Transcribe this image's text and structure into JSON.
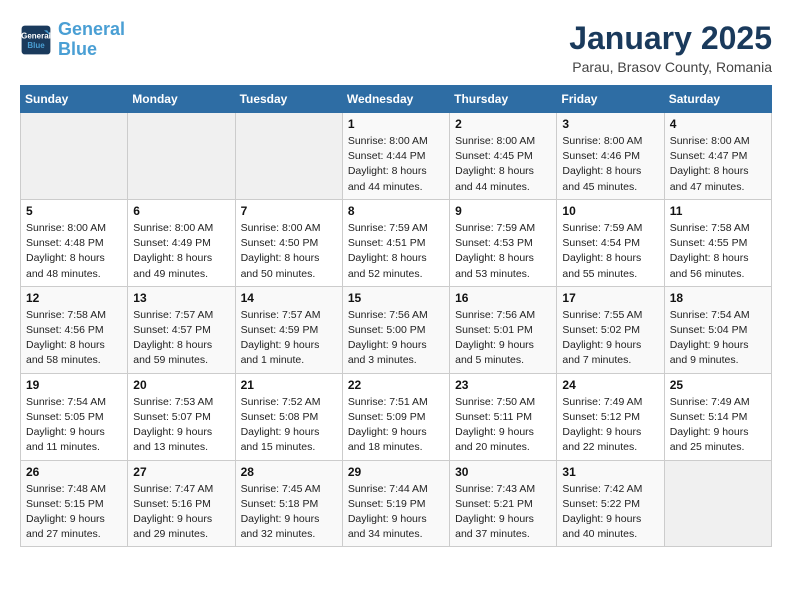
{
  "header": {
    "logo_line1": "General",
    "logo_line2": "Blue",
    "title": "January 2025",
    "subtitle": "Parau, Brasov County, Romania"
  },
  "days_of_week": [
    "Sunday",
    "Monday",
    "Tuesday",
    "Wednesday",
    "Thursday",
    "Friday",
    "Saturday"
  ],
  "weeks": [
    [
      {
        "day": "",
        "info": ""
      },
      {
        "day": "",
        "info": ""
      },
      {
        "day": "",
        "info": ""
      },
      {
        "day": "1",
        "info": "Sunrise: 8:00 AM\nSunset: 4:44 PM\nDaylight: 8 hours\nand 44 minutes."
      },
      {
        "day": "2",
        "info": "Sunrise: 8:00 AM\nSunset: 4:45 PM\nDaylight: 8 hours\nand 44 minutes."
      },
      {
        "day": "3",
        "info": "Sunrise: 8:00 AM\nSunset: 4:46 PM\nDaylight: 8 hours\nand 45 minutes."
      },
      {
        "day": "4",
        "info": "Sunrise: 8:00 AM\nSunset: 4:47 PM\nDaylight: 8 hours\nand 47 minutes."
      }
    ],
    [
      {
        "day": "5",
        "info": "Sunrise: 8:00 AM\nSunset: 4:48 PM\nDaylight: 8 hours\nand 48 minutes."
      },
      {
        "day": "6",
        "info": "Sunrise: 8:00 AM\nSunset: 4:49 PM\nDaylight: 8 hours\nand 49 minutes."
      },
      {
        "day": "7",
        "info": "Sunrise: 8:00 AM\nSunset: 4:50 PM\nDaylight: 8 hours\nand 50 minutes."
      },
      {
        "day": "8",
        "info": "Sunrise: 7:59 AM\nSunset: 4:51 PM\nDaylight: 8 hours\nand 52 minutes."
      },
      {
        "day": "9",
        "info": "Sunrise: 7:59 AM\nSunset: 4:53 PM\nDaylight: 8 hours\nand 53 minutes."
      },
      {
        "day": "10",
        "info": "Sunrise: 7:59 AM\nSunset: 4:54 PM\nDaylight: 8 hours\nand 55 minutes."
      },
      {
        "day": "11",
        "info": "Sunrise: 7:58 AM\nSunset: 4:55 PM\nDaylight: 8 hours\nand 56 minutes."
      }
    ],
    [
      {
        "day": "12",
        "info": "Sunrise: 7:58 AM\nSunset: 4:56 PM\nDaylight: 8 hours\nand 58 minutes."
      },
      {
        "day": "13",
        "info": "Sunrise: 7:57 AM\nSunset: 4:57 PM\nDaylight: 8 hours\nand 59 minutes."
      },
      {
        "day": "14",
        "info": "Sunrise: 7:57 AM\nSunset: 4:59 PM\nDaylight: 9 hours\nand 1 minute."
      },
      {
        "day": "15",
        "info": "Sunrise: 7:56 AM\nSunset: 5:00 PM\nDaylight: 9 hours\nand 3 minutes."
      },
      {
        "day": "16",
        "info": "Sunrise: 7:56 AM\nSunset: 5:01 PM\nDaylight: 9 hours\nand 5 minutes."
      },
      {
        "day": "17",
        "info": "Sunrise: 7:55 AM\nSunset: 5:02 PM\nDaylight: 9 hours\nand 7 minutes."
      },
      {
        "day": "18",
        "info": "Sunrise: 7:54 AM\nSunset: 5:04 PM\nDaylight: 9 hours\nand 9 minutes."
      }
    ],
    [
      {
        "day": "19",
        "info": "Sunrise: 7:54 AM\nSunset: 5:05 PM\nDaylight: 9 hours\nand 11 minutes."
      },
      {
        "day": "20",
        "info": "Sunrise: 7:53 AM\nSunset: 5:07 PM\nDaylight: 9 hours\nand 13 minutes."
      },
      {
        "day": "21",
        "info": "Sunrise: 7:52 AM\nSunset: 5:08 PM\nDaylight: 9 hours\nand 15 minutes."
      },
      {
        "day": "22",
        "info": "Sunrise: 7:51 AM\nSunset: 5:09 PM\nDaylight: 9 hours\nand 18 minutes."
      },
      {
        "day": "23",
        "info": "Sunrise: 7:50 AM\nSunset: 5:11 PM\nDaylight: 9 hours\nand 20 minutes."
      },
      {
        "day": "24",
        "info": "Sunrise: 7:49 AM\nSunset: 5:12 PM\nDaylight: 9 hours\nand 22 minutes."
      },
      {
        "day": "25",
        "info": "Sunrise: 7:49 AM\nSunset: 5:14 PM\nDaylight: 9 hours\nand 25 minutes."
      }
    ],
    [
      {
        "day": "26",
        "info": "Sunrise: 7:48 AM\nSunset: 5:15 PM\nDaylight: 9 hours\nand 27 minutes."
      },
      {
        "day": "27",
        "info": "Sunrise: 7:47 AM\nSunset: 5:16 PM\nDaylight: 9 hours\nand 29 minutes."
      },
      {
        "day": "28",
        "info": "Sunrise: 7:45 AM\nSunset: 5:18 PM\nDaylight: 9 hours\nand 32 minutes."
      },
      {
        "day": "29",
        "info": "Sunrise: 7:44 AM\nSunset: 5:19 PM\nDaylight: 9 hours\nand 34 minutes."
      },
      {
        "day": "30",
        "info": "Sunrise: 7:43 AM\nSunset: 5:21 PM\nDaylight: 9 hours\nand 37 minutes."
      },
      {
        "day": "31",
        "info": "Sunrise: 7:42 AM\nSunset: 5:22 PM\nDaylight: 9 hours\nand 40 minutes."
      },
      {
        "day": "",
        "info": ""
      }
    ]
  ]
}
